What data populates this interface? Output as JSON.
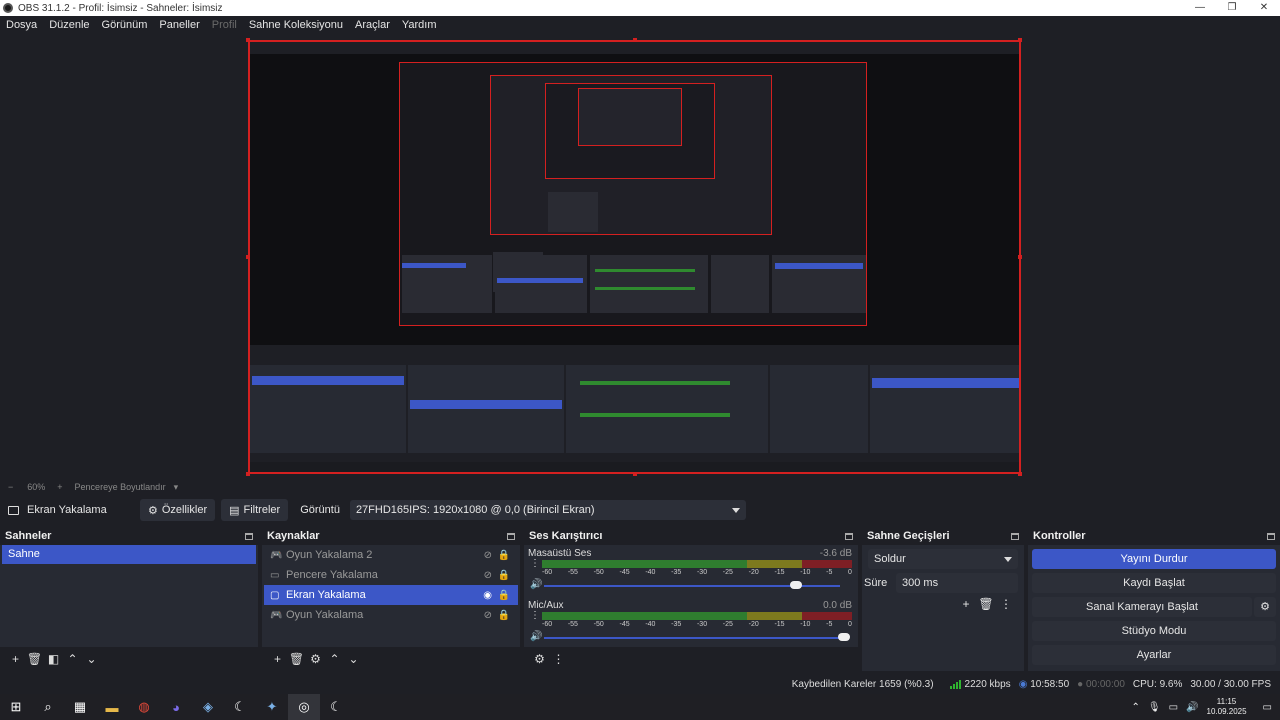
{
  "window": {
    "title": "OBS 31.1.2 - Profil: İsimsiz - Sahneler: İsimsiz",
    "controls": [
      "—",
      "❐",
      "✕"
    ]
  },
  "menu": [
    "Dosya",
    "Düzenle",
    "Görünüm",
    "Paneller",
    "Profil",
    "Sahne Koleksiyonu",
    "Araçlar",
    "Yardım"
  ],
  "zoom": {
    "minus": "−",
    "value": "60%",
    "plus": "+",
    "fit_label": "Pencereye Boyutlandır"
  },
  "source_toolbar": {
    "selected_source": "Ekran Yakalama",
    "properties_label": "Özellikler",
    "filters_label": "Filtreler",
    "display_label": "Görüntü",
    "display_value": "27FHD165IPS: 1920x1080 @ 0,0 (Birincil Ekran)"
  },
  "scenes": {
    "title": "Sahneler",
    "items": [
      "Sahne"
    ]
  },
  "sources": {
    "title": "Kaynaklar",
    "items": [
      {
        "name": "Oyun Yakalama 2",
        "icon": "gamepad-icon"
      },
      {
        "name": "Pencere Yakalama",
        "icon": "window-icon"
      },
      {
        "name": "Ekran Yakalama",
        "icon": "monitor-icon"
      },
      {
        "name": "Oyun Yakalama",
        "icon": "gamepad-icon"
      }
    ]
  },
  "mixer": {
    "title": "Ses Karıştırıcı",
    "scale": [
      "-60",
      "-55",
      "-50",
      "-45",
      "-40",
      "-35",
      "-30",
      "-25",
      "-20",
      "-15",
      "-10",
      "-5",
      "0"
    ],
    "channels": [
      {
        "name": "Masaüstü Ses",
        "db": "-3.6 dB",
        "volume": 1.0
      },
      {
        "name": "Mic/Aux",
        "db": "0.0 dB",
        "volume": 1.0
      }
    ]
  },
  "transitions": {
    "title": "Sahne Geçişleri",
    "selected": "Soldur",
    "duration_label": "Süre",
    "duration_value": "300 ms"
  },
  "controls": {
    "title": "Kontroller",
    "stop_stream": "Yayını Durdur",
    "start_record": "Kaydı Başlat",
    "virtual_cam": "Sanal Kamerayı Başlat",
    "studio_mode": "Stüdyo Modu",
    "settings": "Ayarlar"
  },
  "status": {
    "dropped_frames": "Kaybedilen Kareler 1659 (%0.3)",
    "bitrate": "2220 kbps",
    "stream_time": "10:58:50",
    "record_time": "00:00:00",
    "cpu": "CPU: 9.6%",
    "fps": "30.00 / 30.00 FPS"
  },
  "taskbar": {
    "time": "11:15",
    "date": "10.09.2025"
  },
  "colors": {
    "accent": "#3c57c7",
    "selection_border": "#d42020",
    "background": "#1e1f25",
    "dock": "#272a33"
  }
}
